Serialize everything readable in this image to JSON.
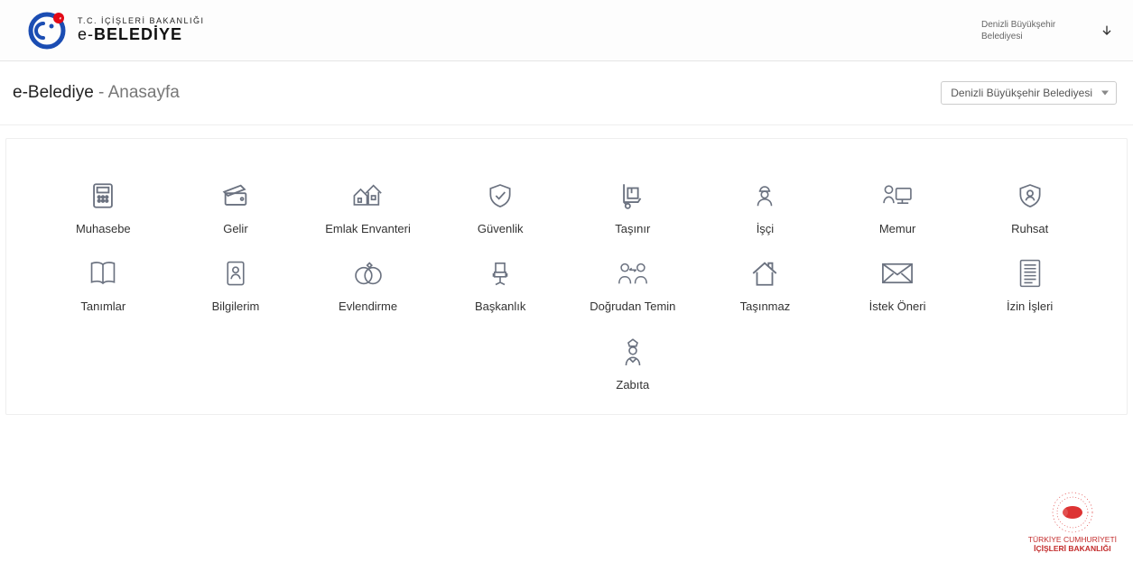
{
  "header": {
    "ministry": "T.C. İÇİŞLERİ BAKANLIĞI",
    "appname_a": "e-",
    "appname_b": "BELEDİYE",
    "municipality": "Denizli Büyükşehir Belediyesi"
  },
  "titlebar": {
    "app": "e-Belediye",
    "sep": " - ",
    "page": "Anasayfa",
    "select_value": "Denizli Büyükşehir Belediyesi"
  },
  "tiles": [
    {
      "label": "Muhasebe"
    },
    {
      "label": "Gelir"
    },
    {
      "label": "Emlak Envanteri"
    },
    {
      "label": "Güvenlik"
    },
    {
      "label": "Taşınır"
    },
    {
      "label": "İşçi"
    },
    {
      "label": "Memur"
    },
    {
      "label": "Ruhsat"
    },
    {
      "label": "Tanımlar"
    },
    {
      "label": "Bilgilerim"
    },
    {
      "label": "Evlendirme"
    },
    {
      "label": "Başkanlık"
    },
    {
      "label": "Doğrudan Temin"
    },
    {
      "label": "Taşınmaz"
    },
    {
      "label": "İstek Öneri"
    },
    {
      "label": "İzin İşleri"
    },
    {
      "label": "Zabıta"
    }
  ],
  "footer": {
    "line1": "TÜRKİYE CUMHURİYETİ",
    "line2": "İÇİŞLERİ BAKANLIĞI"
  }
}
